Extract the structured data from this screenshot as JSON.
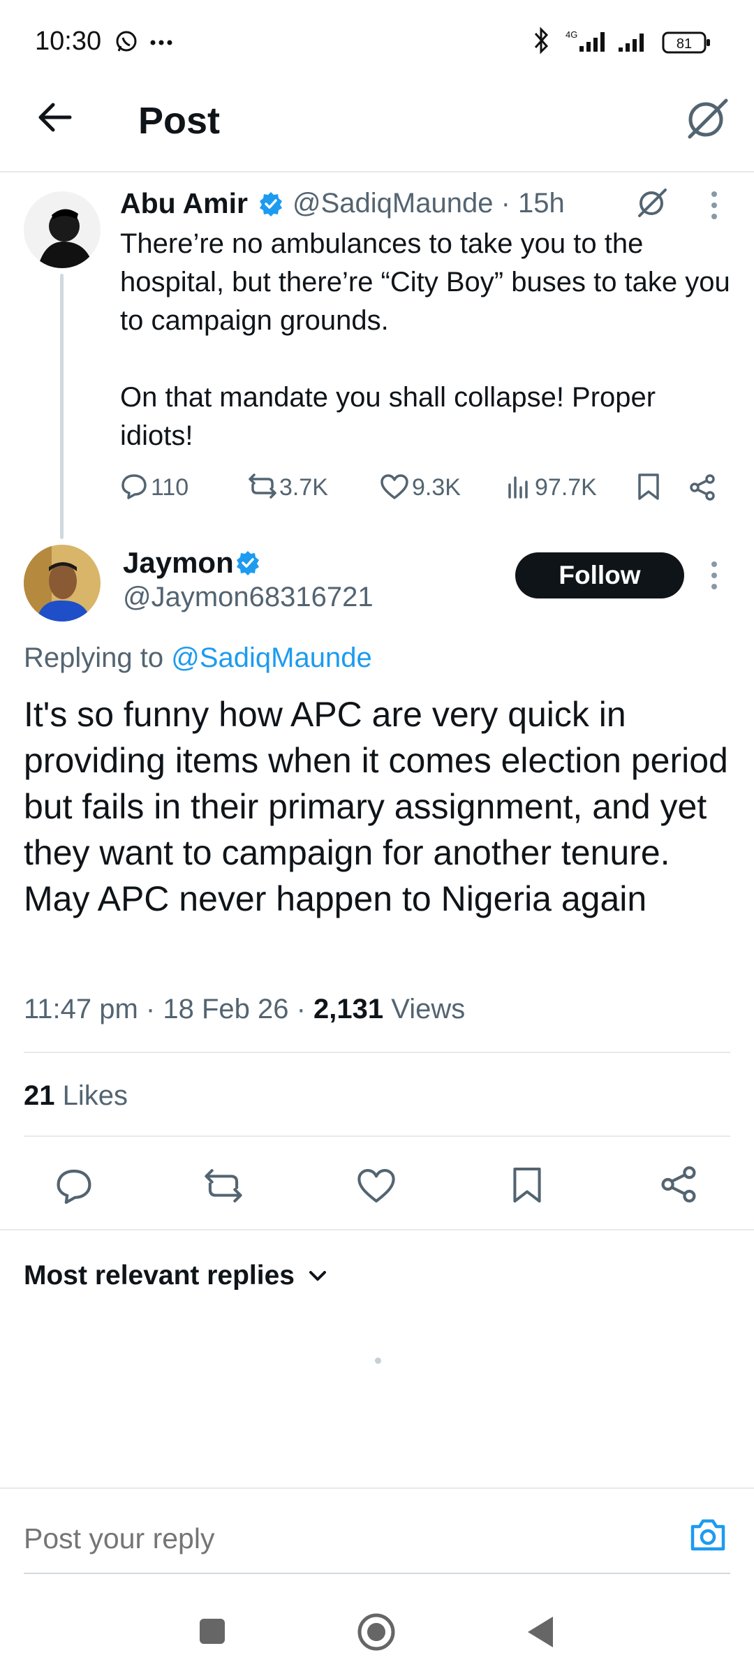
{
  "status_bar": {
    "time": "10:30",
    "network": "4G",
    "battery": "81"
  },
  "header": {
    "title": "Post"
  },
  "parent_post": {
    "author_name": "Abu Amir",
    "author_handle": "@SadiqMaunde · 15h",
    "paragraphs": [
      "There’re no ambulances to take you to the hospital, but there’re “City Boy” buses to take you to campaign grounds.",
      "On that mandate you shall collapse! Proper idiots!"
    ],
    "stats": {
      "replies": "110",
      "reposts": "3.7K",
      "likes": "9.3K",
      "views": "97.7K"
    }
  },
  "main_post": {
    "author_name": "Jaymon",
    "author_handle": "@Jaymon68316721",
    "follow_label": "Follow",
    "replying_prefix": "Replying to",
    "replying_to": "@SadiqMaunde",
    "text": "It's so funny how APC are very quick in providing items when it comes election period but fails in their primary assignment, and yet they want to campaign for another tenure. May APC never happen to Nigeria again",
    "timestamp": "11:47 pm · 18 Feb 26 · ",
    "views_count": "2,131",
    "views_label": " Views",
    "likes_count": "21",
    "likes_label": " Likes"
  },
  "replies_section": {
    "sort_label": "Most relevant replies"
  },
  "composer": {
    "placeholder": "Post your reply"
  },
  "colors": {
    "accent": "#1d9bf0",
    "text_primary": "#0f1419",
    "text_secondary": "#536471",
    "divider": "#e6e9ec"
  }
}
